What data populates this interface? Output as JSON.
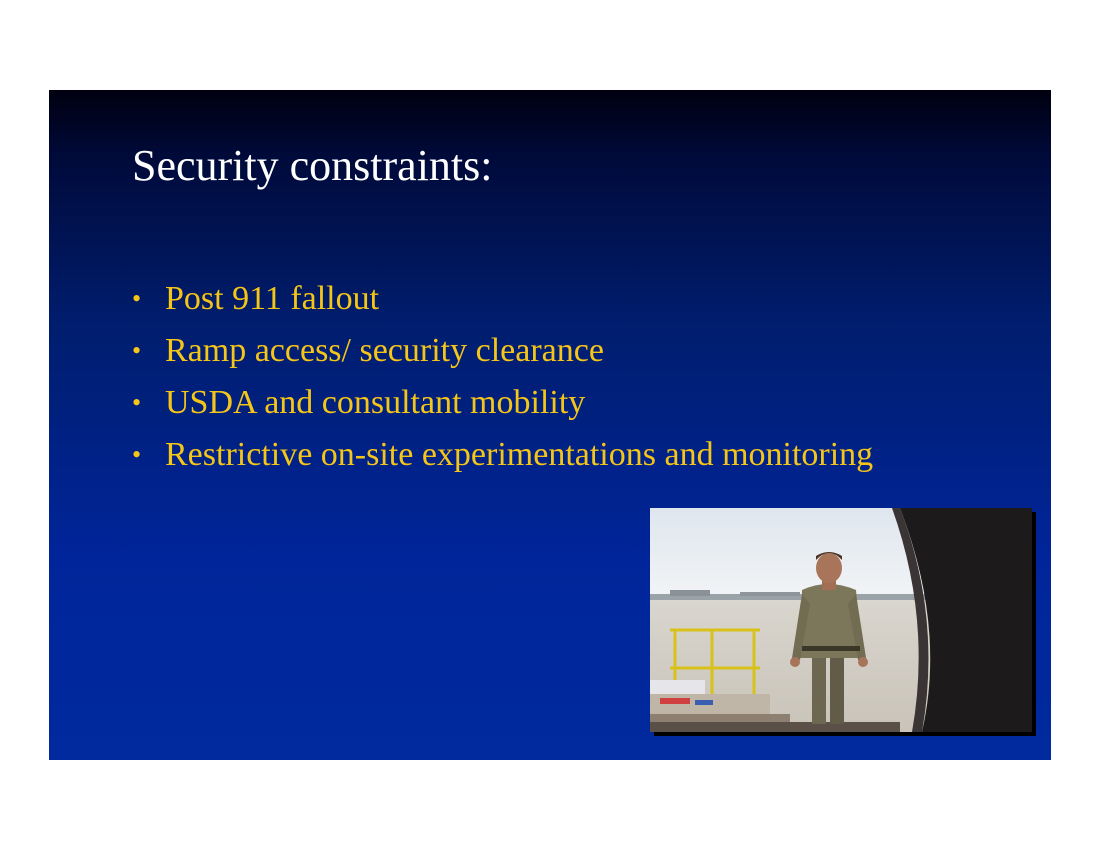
{
  "slide": {
    "title": "Security constraints:",
    "bullets": [
      {
        "marker": "•",
        "text": "Post 911 fallout"
      },
      {
        "marker": "•",
        "text": "Ramp access/ security clearance"
      },
      {
        "marker": "•",
        "text": "USDA and consultant mobility"
      },
      {
        "marker": "•",
        "text": "Restrictive on-site experimentations and monitoring"
      }
    ],
    "colors": {
      "title": "#ffffff",
      "bullet_text": "#f5c518",
      "background_top": "#000010",
      "background_bottom": "#002a9e"
    },
    "photo": {
      "subject": "worker in uniform standing at aircraft cargo door on airport ramp"
    }
  }
}
